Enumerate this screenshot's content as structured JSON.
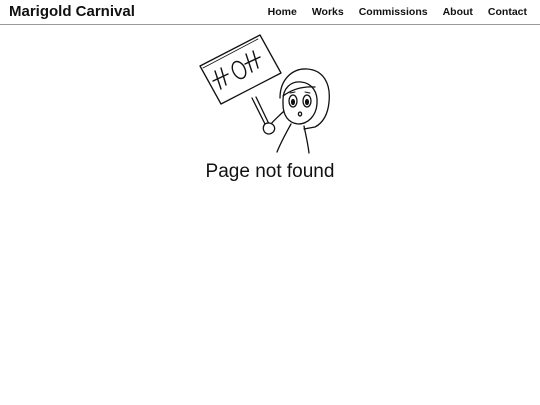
{
  "header": {
    "site_title": "Marigold Carnival",
    "nav": [
      {
        "label": "Home"
      },
      {
        "label": "Works"
      },
      {
        "label": "Commissions"
      },
      {
        "label": "About"
      },
      {
        "label": "Contact"
      }
    ]
  },
  "main": {
    "sign_text": "404",
    "message": "Page not found"
  }
}
